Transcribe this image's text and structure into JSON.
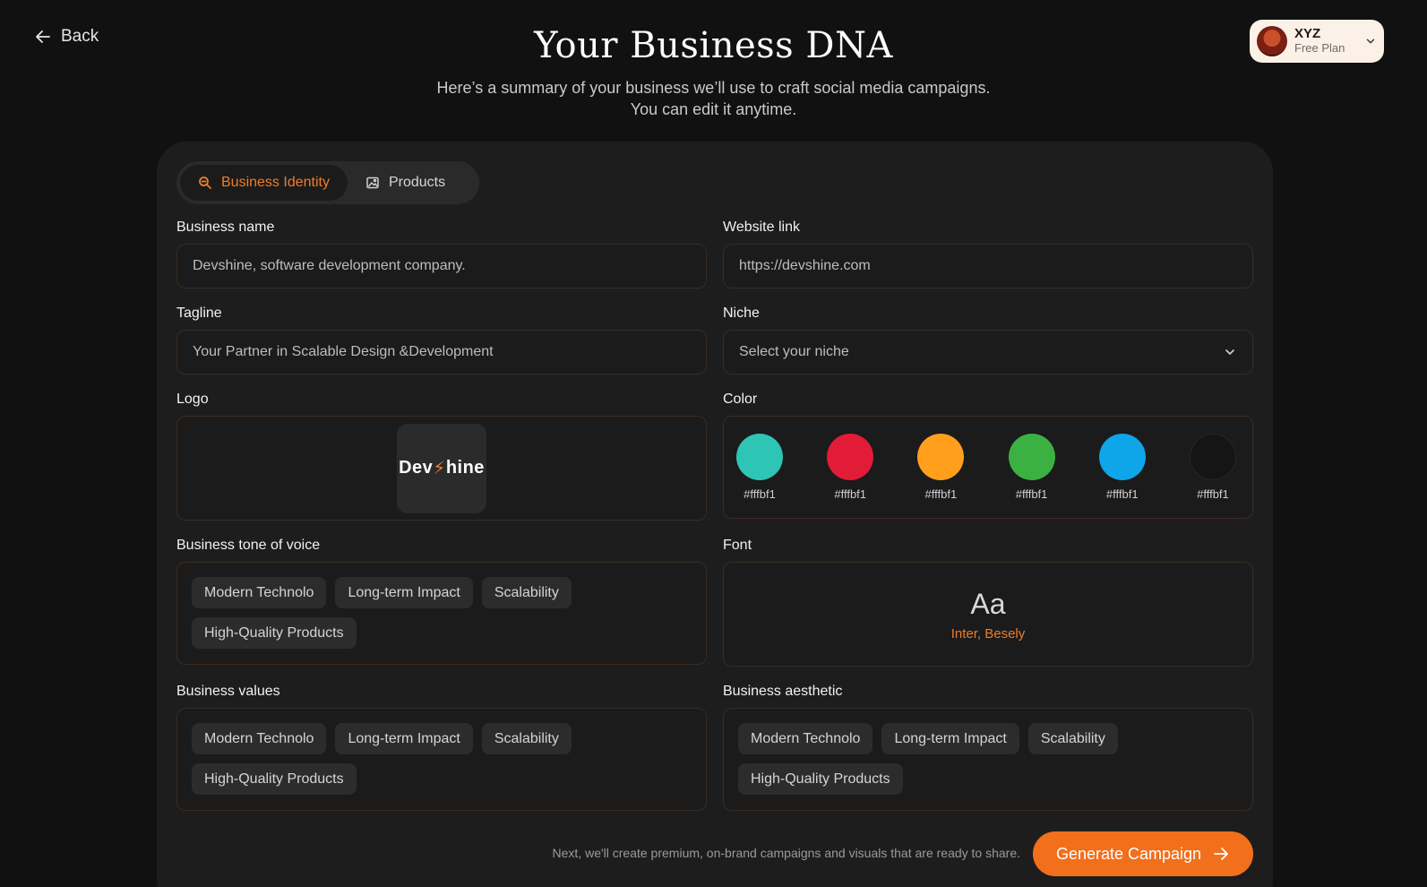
{
  "nav": {
    "back_label": "Back"
  },
  "header": {
    "title": "Your Business DNA",
    "subtitle_line1": "Here’s a summary of your business we’ll use to craft social media campaigns.",
    "subtitle_line2": "You can edit it anytime."
  },
  "user": {
    "name": "XYZ",
    "plan": "Free Plan"
  },
  "tabs": [
    {
      "label": "Business Identity",
      "icon": "search-icon",
      "active": true
    },
    {
      "label": "Products",
      "icon": "image-icon",
      "active": false
    }
  ],
  "form": {
    "business_name": {
      "label": "Business name",
      "value": "Devshine, software development company."
    },
    "website": {
      "label": "Website link",
      "value": "https://devshine.com"
    },
    "tagline": {
      "label": "Tagline",
      "value": "Your Partner in Scalable Design &Development"
    },
    "niche": {
      "label": "Niche",
      "placeholder": "Select your niche"
    },
    "logo": {
      "label": "Logo",
      "text_a": "Dev",
      "text_b": "hine"
    },
    "color": {
      "label": "Color",
      "swatches": [
        {
          "hex": "#2ec4b6",
          "code": "#fffbf1"
        },
        {
          "hex": "#e21b37",
          "code": "#fffbf1"
        },
        {
          "hex": "#ff9f1c",
          "code": "#fffbf1"
        },
        {
          "hex": "#3bb143",
          "code": "#fffbf1"
        },
        {
          "hex": "#0ea5e9",
          "code": "#fffbf1"
        },
        {
          "hex": "#151515",
          "code": "#fffbf1"
        }
      ]
    },
    "tone": {
      "label": "Business tone of voice",
      "tags": [
        "Modern Technolo",
        "Long-term Impact",
        "Scalability",
        "High-Quality Products"
      ]
    },
    "font": {
      "label": "Font",
      "sample": "Aa",
      "name": "Inter, Besely"
    },
    "values": {
      "label": "Business values",
      "tags": [
        "Modern Technolo",
        "Long-term Impact",
        "Scalability",
        "High-Quality Products"
      ]
    },
    "aesthetic": {
      "label": "Business aesthetic",
      "tags": [
        "Modern Technolo",
        "Long-term Impact",
        "Scalability",
        "High-Quality Products"
      ]
    }
  },
  "footer": {
    "note": "Next, we'll create premium, on-brand campaigns and visuals that are ready to share.",
    "cta_label": "Generate Campaign"
  },
  "colors": {
    "accent": "#f26f1b",
    "background": "#111111",
    "panel": "#1d1d1d"
  }
}
